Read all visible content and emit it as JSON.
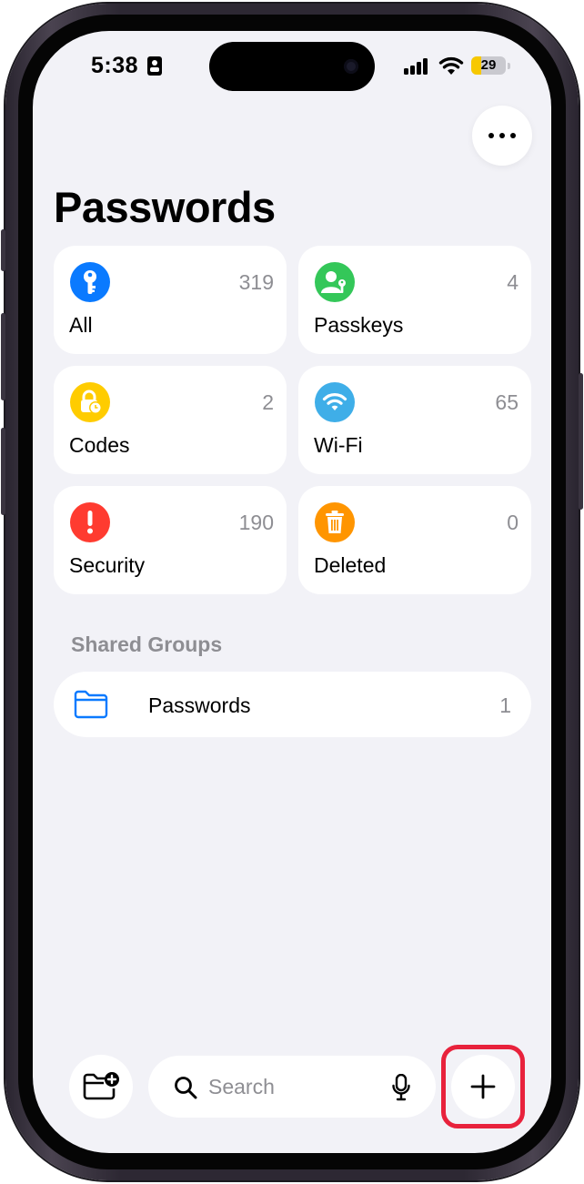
{
  "status_bar": {
    "time": "5:38",
    "battery_level": "29"
  },
  "header": {
    "title": "Passwords",
    "more_icon": "ellipsis-icon"
  },
  "categories": [
    {
      "label": "All",
      "count": "319",
      "icon": "key-icon",
      "color": "#0a7aff"
    },
    {
      "label": "Passkeys",
      "count": "4",
      "icon": "person-key-icon",
      "color": "#34c759"
    },
    {
      "label": "Codes",
      "count": "2",
      "icon": "lock-clock-icon",
      "color": "#ffcc00"
    },
    {
      "label": "Wi-Fi",
      "count": "65",
      "icon": "wifi-icon",
      "color": "#3faee8"
    },
    {
      "label": "Security",
      "count": "190",
      "icon": "exclamation-icon",
      "color": "#ff3b30"
    },
    {
      "label": "Deleted",
      "count": "0",
      "icon": "trash-icon",
      "color": "#ff9500"
    }
  ],
  "shared_groups": {
    "header": "Shared Groups",
    "items": [
      {
        "label": "Passwords",
        "count": "1",
        "icon": "folder-icon"
      }
    ]
  },
  "toolbar": {
    "search_placeholder": "Search",
    "new_group_icon": "folder-plus-icon",
    "mic_icon": "microphone-icon",
    "add_icon": "plus-icon",
    "highlight_color": "#e8223c"
  }
}
